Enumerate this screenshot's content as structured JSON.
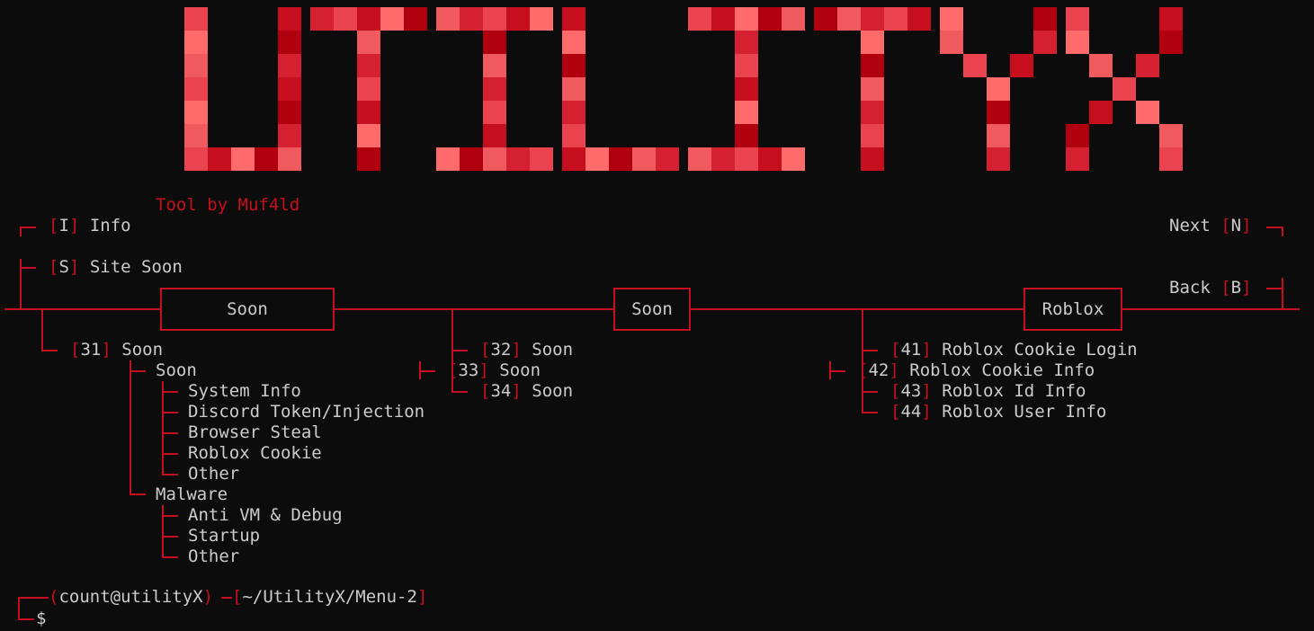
{
  "banner": {
    "text": "UTILITYX"
  },
  "credit": "Tool by Muf4ld",
  "top_left": [
    {
      "key": "I",
      "label": "Info"
    },
    {
      "key": "S",
      "label": "Site Soon"
    }
  ],
  "top_right": [
    {
      "key": "N",
      "label": "Next"
    },
    {
      "key": "B",
      "label": "Back"
    }
  ],
  "categories": [
    {
      "label": "Soon"
    },
    {
      "label": "Soon"
    },
    {
      "label": "Roblox"
    }
  ],
  "col1": {
    "item_num": "31",
    "item_label": "Soon",
    "group1": {
      "label": "Soon",
      "items": [
        "System Info",
        "Discord Token/Injection",
        "Browser Steal",
        "Roblox Cookie",
        "Other"
      ]
    },
    "group2": {
      "label": "Malware",
      "items": [
        "Anti VM & Debug",
        "Startup",
        "Other"
      ]
    }
  },
  "col2": [
    {
      "num": "32",
      "label": "Soon"
    },
    {
      "num": "33",
      "label": "Soon"
    },
    {
      "num": "34",
      "label": "Soon"
    }
  ],
  "col3": [
    {
      "num": "41",
      "label": "Roblox Cookie Login"
    },
    {
      "num": "42",
      "label": "Roblox Cookie Info"
    },
    {
      "num": "43",
      "label": "Roblox Id Info"
    },
    {
      "num": "44",
      "label": "Roblox User Info"
    }
  ],
  "prompt": {
    "user": "count@utilityX",
    "path": "~/UtilityX/Menu-2",
    "symbol": "$"
  },
  "colors": {
    "accent": "#c50f1f",
    "text": "#cccccc",
    "background": "#0c0c0c"
  }
}
